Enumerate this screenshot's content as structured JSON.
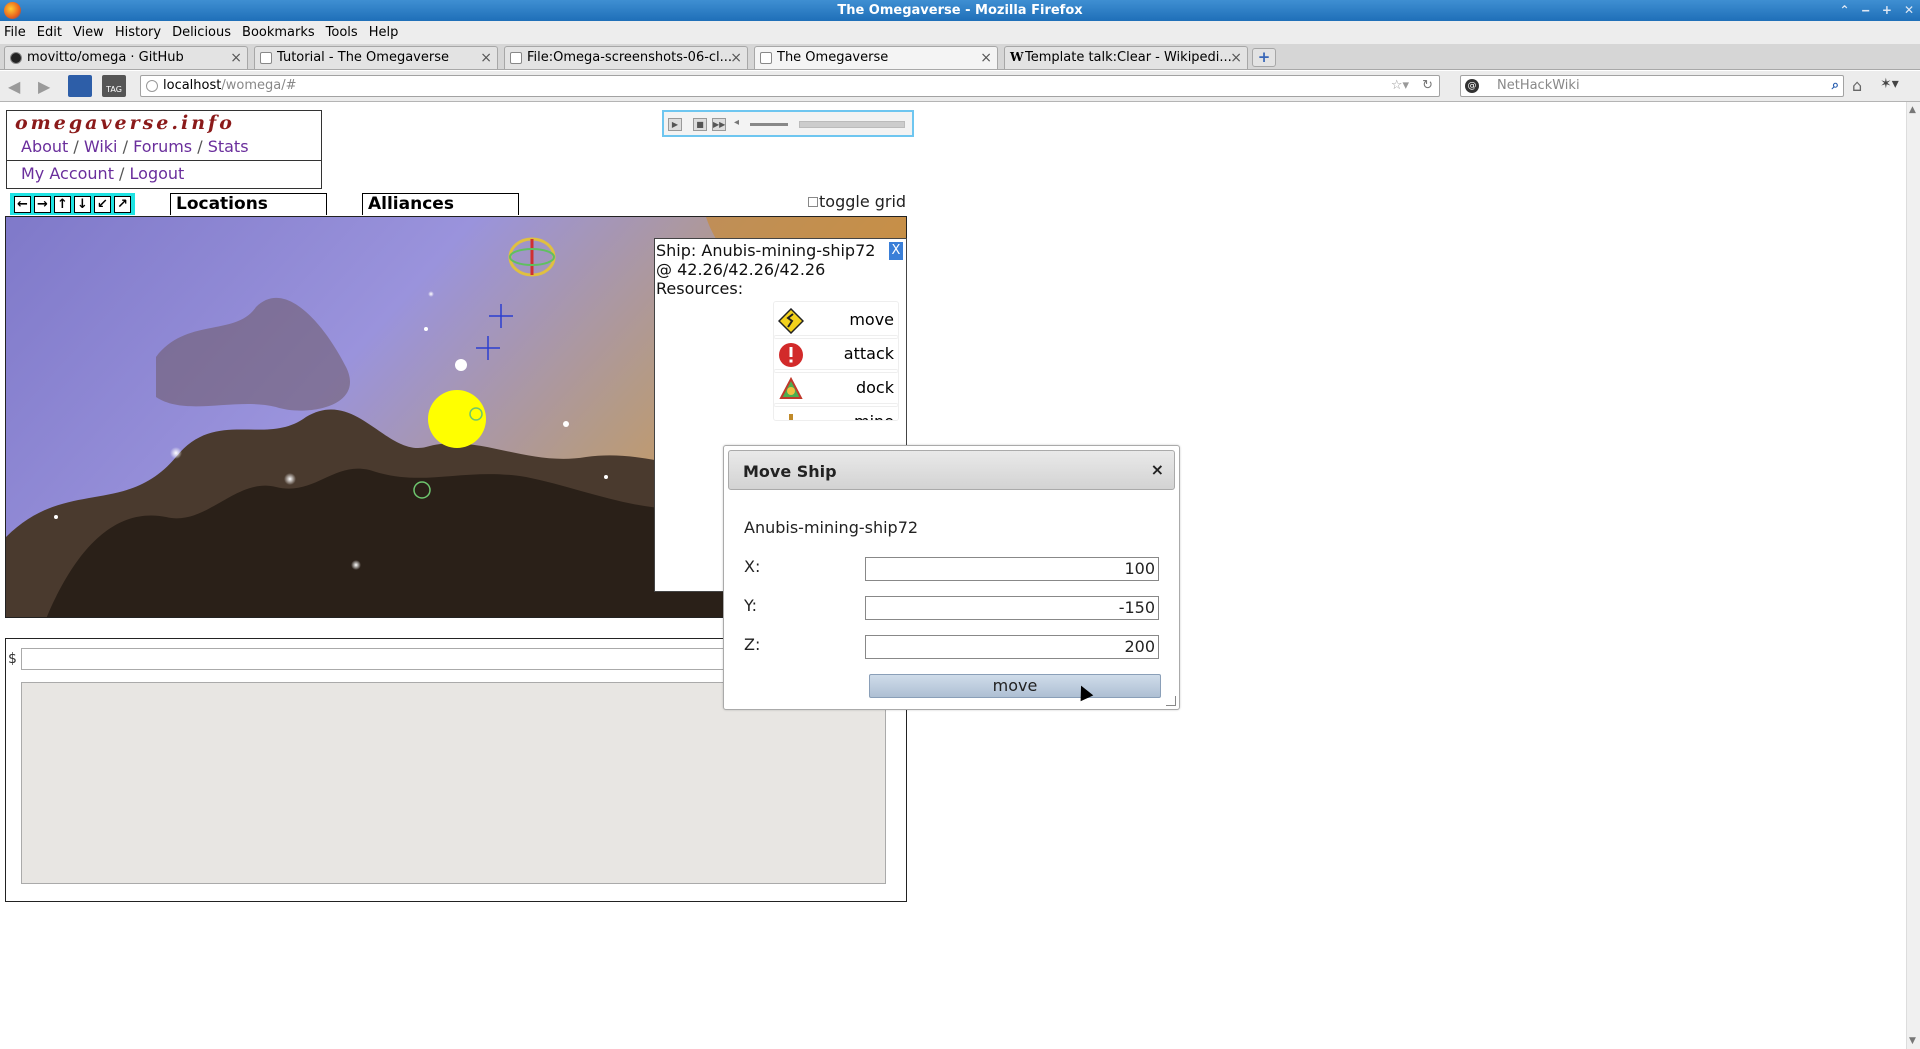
{
  "window": {
    "title": "The Omegaverse - Mozilla Firefox"
  },
  "menu": [
    "File",
    "Edit",
    "View",
    "History",
    "Delicious",
    "Bookmarks",
    "Tools",
    "Help"
  ],
  "tabs": [
    {
      "label": "movitto/omega · GitHub",
      "icon": "github-icon"
    },
    {
      "label": "Tutorial - The Omegaverse",
      "icon": "page-icon"
    },
    {
      "label": "File:Omega-screenshots-06-cl...",
      "icon": "page-icon"
    },
    {
      "label": "The Omegaverse",
      "icon": "page-icon",
      "active": true
    },
    {
      "label": "Template talk:Clear - Wikipedi...",
      "icon": "wikipedia-icon"
    }
  ],
  "urlbar": {
    "host": "localhost",
    "path": "/womega/#"
  },
  "searchbar": {
    "placeholder": "NetHackWiki"
  },
  "site": {
    "logo": "omegaverse.info",
    "links": [
      "About",
      "Wiki",
      "Forums",
      "Stats"
    ],
    "account_links": [
      "My Account",
      "Logout"
    ]
  },
  "panels": {
    "locations": "Locations",
    "alliances": "Alliances",
    "toggle_grid": "toggle grid"
  },
  "ship_panel": {
    "close": "X",
    "ship_line": "Ship: Anubis-mining-ship72",
    "coords_line": "@ 42.26/42.26/42.26",
    "resources_label": "Resources:",
    "commands": [
      "move",
      "attack",
      "dock",
      "mine"
    ]
  },
  "console": {
    "prompt": "$"
  },
  "dialog": {
    "title": "Move Ship",
    "close": "×",
    "ship_name": "Anubis-mining-ship72",
    "fields": [
      {
        "label": "X:",
        "value": "100"
      },
      {
        "label": "Y:",
        "value": "-150"
      },
      {
        "label": "Z:",
        "value": "200"
      }
    ],
    "submit": "move"
  },
  "colors": {
    "titlebar": "#1f6fb8",
    "link": "#6a2e9c",
    "logo": "#8b1a1a",
    "arrows_bg": "#1fe3e3",
    "star": "#ffff00"
  }
}
